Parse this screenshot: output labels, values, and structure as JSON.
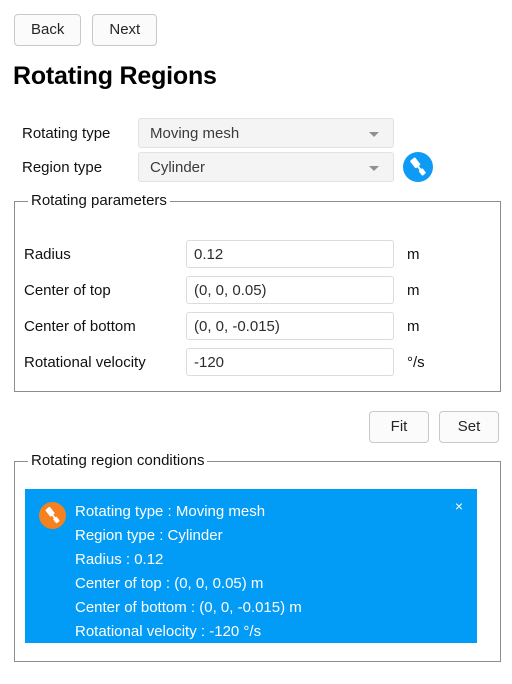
{
  "nav": {
    "back_label": "Back",
    "next_label": "Next"
  },
  "page_title": "Rotating Regions",
  "form": {
    "rotating_type": {
      "label": "Rotating type",
      "value": "Moving mesh"
    },
    "region_type": {
      "label": "Region type",
      "value": "Cylinder"
    },
    "picker_icon": "paint-roller-icon"
  },
  "params_group": {
    "title": "Rotating parameters",
    "rows": [
      {
        "label": "Radius",
        "value": "0.12",
        "unit": "m"
      },
      {
        "label": "Center of top",
        "value": "(0, 0, 0.05)",
        "unit": "m"
      },
      {
        "label": "Center of bottom",
        "value": "(0, 0, -0.015)",
        "unit": "m"
      },
      {
        "label": "Rotational velocity",
        "value": "-120",
        "unit": "°/s"
      }
    ]
  },
  "actions": {
    "fit_label": "Fit",
    "set_label": "Set"
  },
  "conditions_group": {
    "title": "Rotating region conditions",
    "banner": {
      "background_color": "#029bf5",
      "icon": "paint-roller-icon",
      "icon_color": "#f5821f",
      "close_label": "×",
      "lines": [
        "Rotating type : Moving mesh",
        "Region type : Cylinder",
        "Radius : 0.12",
        "Center of top : (0, 0, 0.05) m",
        "Center of bottom : (0, 0, -0.015) m",
        "Rotational velocity : -120 °/s"
      ]
    }
  }
}
